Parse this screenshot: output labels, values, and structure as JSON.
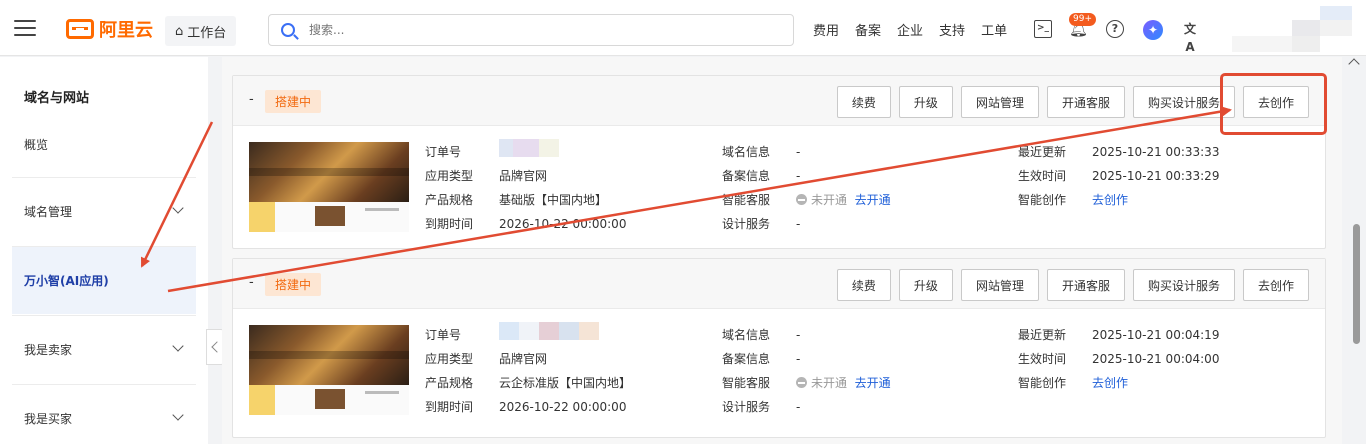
{
  "header": {
    "logo_text": "阿里云",
    "workbench": "工作台",
    "search_placeholder": "搜索...",
    "nav": [
      "费用",
      "备案",
      "企业",
      "支持",
      "工单"
    ],
    "terminal_glyph": ">_",
    "notification_badge": "99+",
    "help_glyph": "?",
    "ai_glyph": "✦",
    "lang_glyph": "文A"
  },
  "sidebar": {
    "title": "域名与网站",
    "items": [
      {
        "label": "概览"
      },
      {
        "label": "域名管理"
      },
      {
        "label": "万小智(AI应用)"
      },
      {
        "label": "我是卖家"
      },
      {
        "label": "我是买家"
      }
    ]
  },
  "cards": [
    {
      "dash": "-",
      "status": "搭建中",
      "buttons": [
        "续费",
        "升级",
        "网站管理",
        "开通客服",
        "购买设计服务",
        "去创作"
      ],
      "col1": [
        {
          "label": "订单号",
          "value": ""
        },
        {
          "label": "应用类型",
          "value": "品牌官网"
        },
        {
          "label": "产品规格",
          "value": "基础版【中国内地】"
        },
        {
          "label": "到期时间",
          "value": "2026-10-22 00:00:00"
        }
      ],
      "col2": [
        {
          "label": "域名信息",
          "value": "-"
        },
        {
          "label": "备案信息",
          "value": "-"
        },
        {
          "label": "智能客服",
          "value": "未开通",
          "link": "去开通"
        },
        {
          "label": "设计服务",
          "value": "-"
        }
      ],
      "col3": [
        {
          "label": "最近更新",
          "value": "2025-10-21 00:33:33"
        },
        {
          "label": "生效时间",
          "value": "2025-10-21 00:33:29"
        },
        {
          "label": "智能创作",
          "link": "去创作"
        }
      ]
    },
    {
      "dash": "-",
      "status": "搭建中",
      "buttons": [
        "续费",
        "升级",
        "网站管理",
        "开通客服",
        "购买设计服务",
        "去创作"
      ],
      "col1": [
        {
          "label": "订单号",
          "value": ""
        },
        {
          "label": "应用类型",
          "value": "品牌官网"
        },
        {
          "label": "产品规格",
          "value": "云企标准版【中国内地】"
        },
        {
          "label": "到期时间",
          "value": "2026-10-22 00:00:00"
        }
      ],
      "col2": [
        {
          "label": "域名信息",
          "value": "-"
        },
        {
          "label": "备案信息",
          "value": "-"
        },
        {
          "label": "智能客服",
          "value": "未开通",
          "link": "去开通"
        },
        {
          "label": "设计服务",
          "value": "-"
        }
      ],
      "col3": [
        {
          "label": "最近更新",
          "value": "2025-10-21 00:04:19"
        },
        {
          "label": "生效时间",
          "value": "2025-10-21 00:04:00"
        },
        {
          "label": "智能创作",
          "link": "去创作"
        }
      ]
    }
  ],
  "colors": {
    "brand": "#ff6a00",
    "annotation": "#e14b32",
    "link": "#1f5fd8",
    "status_bg": "#fde6d3"
  }
}
